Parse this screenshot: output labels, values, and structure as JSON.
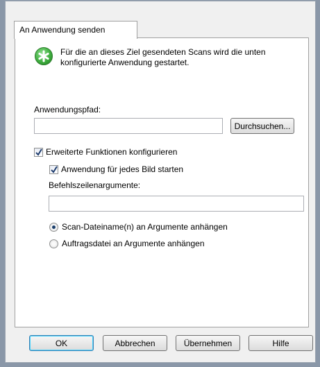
{
  "tab": {
    "label": "An Anwendung senden"
  },
  "info": {
    "icon": "green-star-icon",
    "text": "Für die an dieses Ziel gesendeten Scans wird die unten konfigurierte Anwendung gestartet."
  },
  "app_path": {
    "label": "Anwendungspfad:",
    "value": "",
    "browse_label": "Durchsuchen..."
  },
  "advanced": {
    "label": "Erweiterte Funktionen konfigurieren",
    "checked": true,
    "per_image": {
      "label": "Anwendung für jedes Bild starten",
      "checked": true
    },
    "args_label": "Befehlszeilenargumente:",
    "args_value": "",
    "radio_options": [
      {
        "label": "Scan-Dateiname(n) an Argumente anhängen",
        "selected": true
      },
      {
        "label": "Auftragsdatei an Argumente anhängen",
        "selected": false
      }
    ]
  },
  "buttons": {
    "ok": "OK",
    "cancel": "Abbrechen",
    "apply": "Übernehmen",
    "help": "Hilfe"
  }
}
